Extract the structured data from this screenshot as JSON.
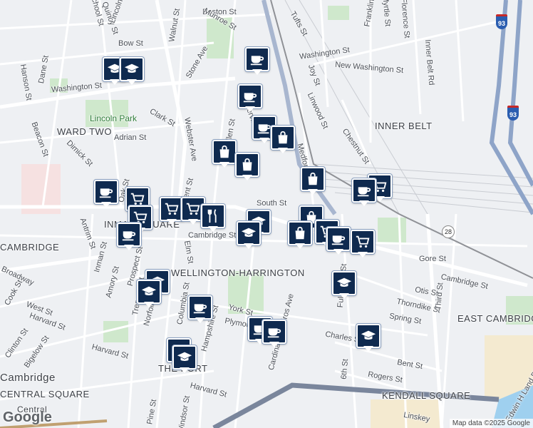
{
  "map": {
    "attribution": "Map data ©2025 Google",
    "logo": "Google",
    "route_shields": [
      "28",
      "93",
      "93"
    ],
    "streets": [
      "Boston St",
      "Munroe St",
      "Walnut St",
      "Bow St",
      "Quincy St",
      "Stone Ave",
      "Washington St",
      "Washington St",
      "Somerville",
      "Allen St",
      "Clark St",
      "Adrian St",
      "Webster Ave",
      "Dane St",
      "Hanson St",
      "Beacon St",
      "Dimick St",
      "Oak St",
      "South St",
      "Medford St",
      "Joy St",
      "Linwood St",
      "Chestnut St",
      "New Washington St",
      "Tufts St",
      "Inner Belt Rd",
      "Cambridge St",
      "Cambridge St",
      "Antrim St",
      "Inman St",
      "Amory St",
      "Prospect St",
      "Elm St",
      "Columbia St",
      "Tremont St",
      "Norfolk St",
      "York St",
      "Plymouth St",
      "Hampshire St",
      "Cardinal Medeiros Ave",
      "Fulkerson St",
      "Gore St",
      "Otis St",
      "Thorndike St",
      "Spring St",
      "Charles St",
      "Bent St",
      "Rogers St",
      "Third St",
      "6th St",
      "West St",
      "Harvard St",
      "Harvard St",
      "Harvard St",
      "Clinton St",
      "Bigelow St",
      "Broadway",
      "Cook St",
      "Pine St",
      "Windsor St",
      "Linskey",
      "Edwin H Land Blvd",
      "Florence St",
      "Myrtle St",
      "Franklin St",
      "School St",
      "Kent St",
      "Lincoln St"
    ],
    "areas": [
      "WARD TWO",
      "INNER BELT",
      "INMAN SQUARE",
      "CAMBRIDGE",
      "WELLINGTON-HARRINGTON",
      "EAST CAMBRIDGE",
      "THE PORT",
      "KENDALL SQUARE",
      "CENTRAL SQUARE",
      "Cambridge",
      "Central"
    ],
    "parks": [
      "Lincoln Park"
    ]
  }
}
